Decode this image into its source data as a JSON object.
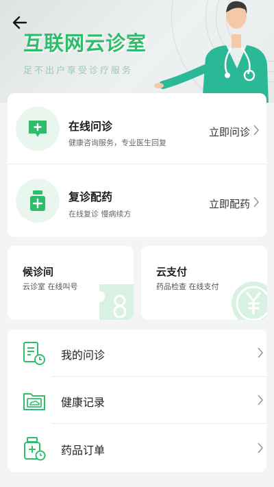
{
  "header": {
    "title": "互联网云诊室",
    "subtitle": "足不出户享受诊疗服务"
  },
  "colors": {
    "accent": "#2fbd6b",
    "icon_bg": "#e8f6ee",
    "page_bg": "#f3f5f5"
  },
  "services": [
    {
      "title": "在线问诊",
      "desc": "健康咨询服务，专业医生回复",
      "action": "立即问诊",
      "icon": "chat-plus-icon"
    },
    {
      "title": "复诊配药",
      "desc": "在线复诊 慢病续方",
      "action": "立即配药",
      "icon": "medicine-bottle-icon"
    }
  ],
  "quick_cards": [
    {
      "title": "候诊间",
      "desc": "云诊室 在线叫号",
      "icon": "queue-number-icon"
    },
    {
      "title": "云支付",
      "desc": "药品检查 在线支付",
      "icon": "yen-coin-icon"
    }
  ],
  "menu": [
    {
      "label": "我的问诊",
      "icon": "consultation-document-icon"
    },
    {
      "label": "健康记录",
      "icon": "health-record-folder-icon"
    },
    {
      "label": "药品订单",
      "icon": "medicine-order-icon"
    }
  ]
}
